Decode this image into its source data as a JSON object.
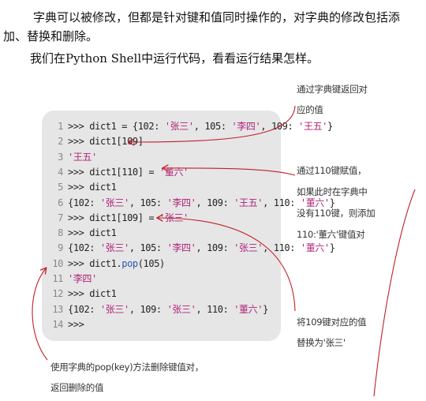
{
  "intro": {
    "paragraph1": "字典可以被修改，但都是针对键和值同时操作的，对字典的修改包括添加、替换和删除。",
    "paragraph2": "我们在Python Shell中运行代码，看看运行结果怎样。"
  },
  "code": [
    {
      "n": "1",
      "segs": [
        {
          "t": ">>> dict1 = {102: ",
          "c": ""
        },
        {
          "t": "'张三'",
          "c": "str"
        },
        {
          "t": ", 105: ",
          "c": ""
        },
        {
          "t": "'李四'",
          "c": "str"
        },
        {
          "t": ", 109: ",
          "c": ""
        },
        {
          "t": "'王五'",
          "c": "str"
        },
        {
          "t": "}",
          "c": ""
        }
      ]
    },
    {
      "n": "2",
      "segs": [
        {
          "t": ">>> dict1[109]",
          "c": ""
        }
      ]
    },
    {
      "n": "3",
      "segs": [
        {
          "t": "'王五'",
          "c": "str"
        }
      ]
    },
    {
      "n": "4",
      "segs": [
        {
          "t": ">>> dict1[110] = ",
          "c": ""
        },
        {
          "t": "'董六'",
          "c": "str"
        }
      ]
    },
    {
      "n": "5",
      "segs": [
        {
          "t": ">>> dict1",
          "c": ""
        }
      ]
    },
    {
      "n": "6",
      "segs": [
        {
          "t": "{102: ",
          "c": ""
        },
        {
          "t": "'张三'",
          "c": "str"
        },
        {
          "t": ", 105: ",
          "c": ""
        },
        {
          "t": "'李四'",
          "c": "str"
        },
        {
          "t": ", 109: ",
          "c": ""
        },
        {
          "t": "'王五'",
          "c": "str"
        },
        {
          "t": ", 110: ",
          "c": ""
        },
        {
          "t": "'董六'",
          "c": "str"
        },
        {
          "t": "}",
          "c": ""
        }
      ]
    },
    {
      "n": "7",
      "segs": [
        {
          "t": ">>> dict1[109] = ",
          "c": ""
        },
        {
          "t": "'张三'",
          "c": "str"
        }
      ]
    },
    {
      "n": "8",
      "segs": [
        {
          "t": ">>> dict1",
          "c": ""
        }
      ]
    },
    {
      "n": "9",
      "segs": [
        {
          "t": "{102: ",
          "c": ""
        },
        {
          "t": "'张三'",
          "c": "str"
        },
        {
          "t": ", 105: ",
          "c": ""
        },
        {
          "t": "'李四'",
          "c": "str"
        },
        {
          "t": ", 109: ",
          "c": ""
        },
        {
          "t": "'张三'",
          "c": "str"
        },
        {
          "t": ", 110: ",
          "c": ""
        },
        {
          "t": "'董六'",
          "c": "str"
        },
        {
          "t": "}",
          "c": ""
        }
      ]
    },
    {
      "n": "10",
      "segs": [
        {
          "t": ">>> dict1.",
          "c": ""
        },
        {
          "t": "pop",
          "c": "fn"
        },
        {
          "t": "(105)",
          "c": ""
        }
      ]
    },
    {
      "n": "11",
      "segs": [
        {
          "t": "'李四'",
          "c": "str"
        }
      ]
    },
    {
      "n": "12",
      "segs": [
        {
          "t": ">>> dict1",
          "c": ""
        }
      ]
    },
    {
      "n": "13",
      "segs": [
        {
          "t": "{102: ",
          "c": ""
        },
        {
          "t": "'张三'",
          "c": "str"
        },
        {
          "t": ", 109: ",
          "c": ""
        },
        {
          "t": "'张三'",
          "c": "str"
        },
        {
          "t": ", 110: ",
          "c": ""
        },
        {
          "t": "'董六'",
          "c": "str"
        },
        {
          "t": "}",
          "c": ""
        }
      ]
    },
    {
      "n": "14",
      "segs": [
        {
          "t": ">>>",
          "c": ""
        }
      ]
    }
  ],
  "annotations": {
    "get_value": [
      "通过字典键返回对",
      "应的值"
    ],
    "add_key": [
      "通过110键赋值，",
      "如果此时在字典中",
      "没有110键，则添加",
      "110:'董六'键值对"
    ],
    "replace_value": [
      "将109键对应的值",
      "替换为'张三'"
    ],
    "pop_method": [
      "使用字典的pop(key)方法删除键值对，",
      "返回删除的值"
    ]
  },
  "colors": {
    "string": "#b0237a",
    "function": "#2a55b8",
    "arrow": "#c0202a",
    "code_background": "#e6e6e6"
  }
}
